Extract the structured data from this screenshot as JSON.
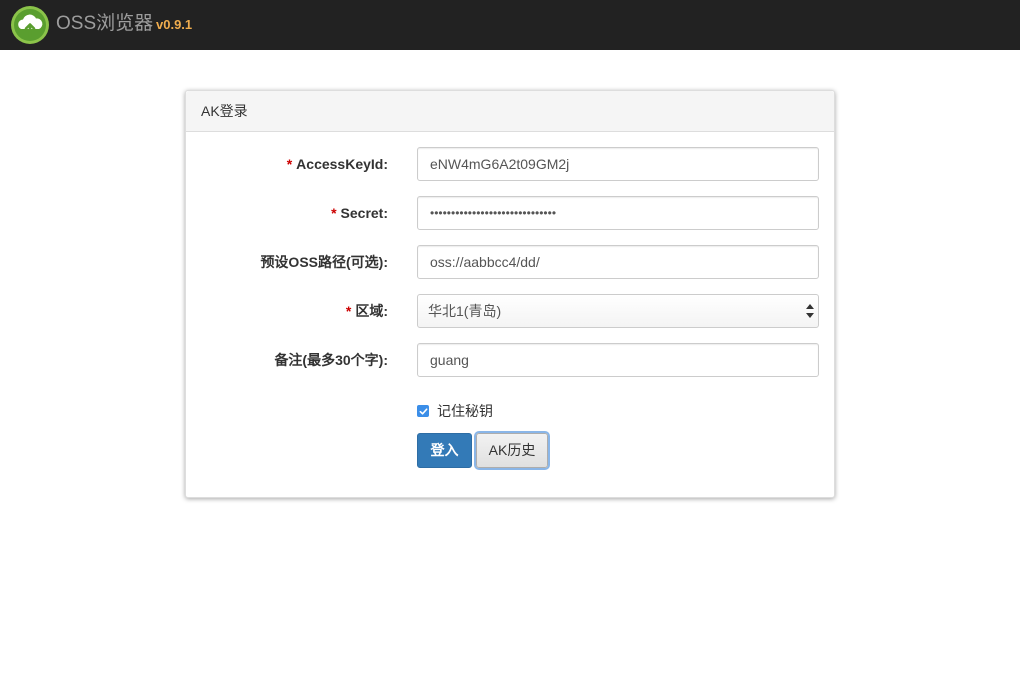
{
  "app": {
    "title": "OSS浏览器",
    "version": "v0.9.1",
    "logo_icon": "cloud-upload-icon",
    "version_color": "#f0ad4e",
    "header_bg": "#222222"
  },
  "panel": {
    "title": "AK登录"
  },
  "form": {
    "access_key_id": {
      "required": "*",
      "label": "AccessKeyId:",
      "value": "eNW4mG6A2t09GM2j"
    },
    "secret": {
      "required": "*",
      "label": "Secret:",
      "value": "••••••••••••••••••••••••••••••"
    },
    "oss_path": {
      "label": "预设OSS路径(可选):",
      "value": "oss://aabbcc4/dd/"
    },
    "region": {
      "required": "*",
      "label": "区域:",
      "selected": "华北1(青岛)"
    },
    "remark": {
      "label": "备注(最多30个字):",
      "value": "guang"
    },
    "remember": {
      "label": "记住秘钥",
      "checked": true
    },
    "login_button": "登入",
    "history_button": "AK历史"
  },
  "colors": {
    "primary": "#337ab7",
    "required": "#cc0000",
    "checkbox": "#3b8ee8"
  }
}
